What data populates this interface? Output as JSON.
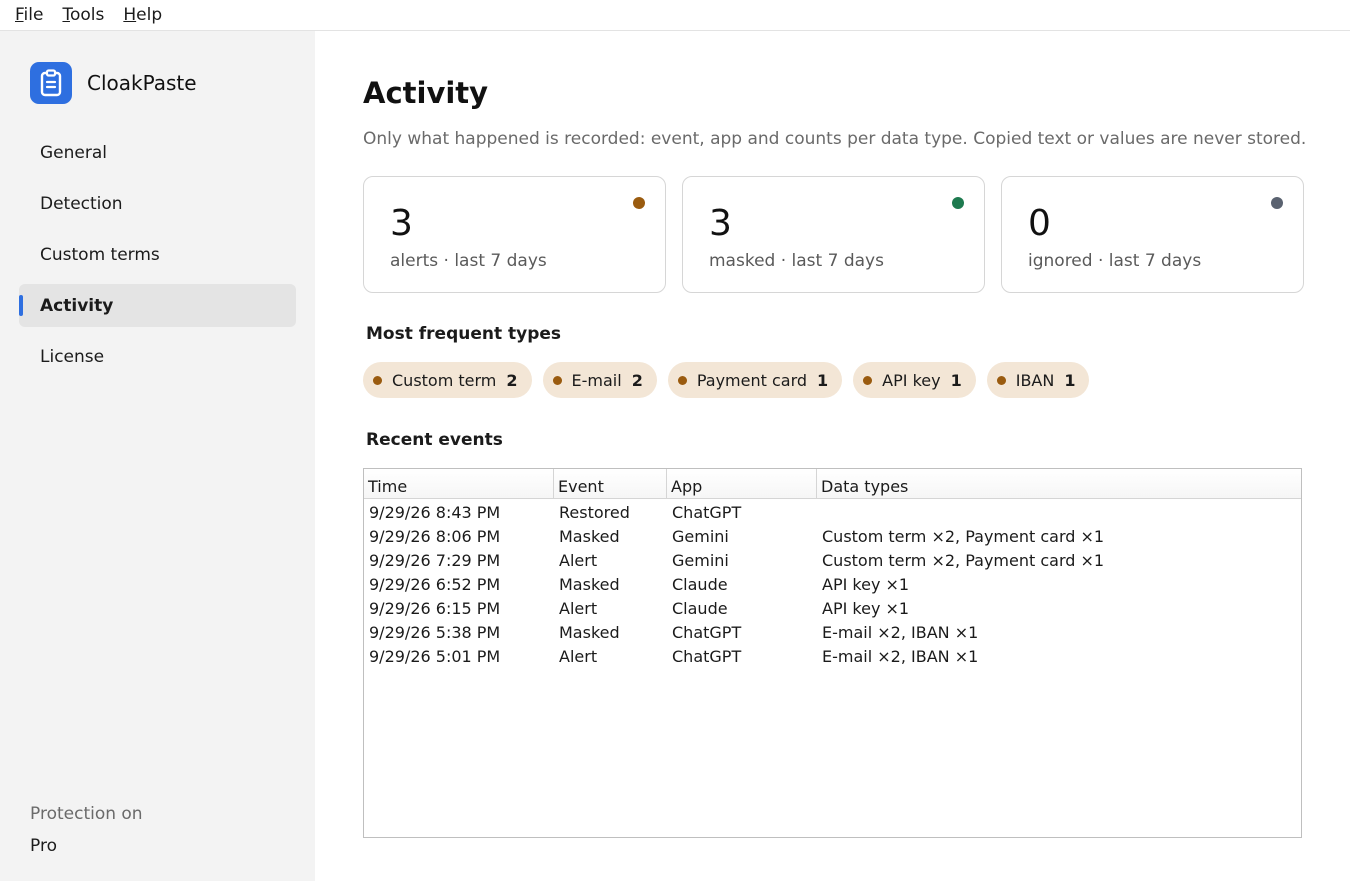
{
  "menu": [
    {
      "mnemonic": "F",
      "rest": "ile"
    },
    {
      "mnemonic": "T",
      "rest": "ools"
    },
    {
      "mnemonic": "H",
      "rest": "elp"
    }
  ],
  "app": {
    "name": "CloakPaste",
    "icon": "clipboard-icon",
    "accent": "#2e6fe0"
  },
  "sidebar": {
    "items": [
      {
        "label": "General"
      },
      {
        "label": "Detection"
      },
      {
        "label": "Custom terms"
      },
      {
        "label": "Activity",
        "active": true
      },
      {
        "label": "License"
      }
    ],
    "status": "Protection on",
    "plan": "Pro"
  },
  "page": {
    "title": "Activity",
    "subtitle": "Only what happened is recorded: event, app and counts per data type. Copied text or values are never stored."
  },
  "cards": [
    {
      "value": "3",
      "label": "alerts · last 7 days",
      "color": "#9a5b0f"
    },
    {
      "value": "3",
      "label": "masked · last 7 days",
      "color": "#1e7a4f"
    },
    {
      "value": "0",
      "label": "ignored · last 7 days",
      "color": "#5a6270"
    }
  ],
  "types": {
    "heading": "Most frequent types",
    "chips": [
      {
        "label": "Custom term",
        "count": "2"
      },
      {
        "label": "E-mail",
        "count": "2"
      },
      {
        "label": "Payment card",
        "count": "1"
      },
      {
        "label": "API key",
        "count": "1"
      },
      {
        "label": "IBAN",
        "count": "1"
      }
    ],
    "chip_color": "#9a5b0f"
  },
  "events": {
    "heading": "Recent events",
    "columns": [
      "Time",
      "Event",
      "App",
      "Data types"
    ],
    "rows": [
      [
        "9/29/26 8:43 PM",
        "Restored",
        "ChatGPT",
        ""
      ],
      [
        "9/29/26 8:06 PM",
        "Masked",
        "Gemini",
        "Custom term ×2, Payment card ×1"
      ],
      [
        "9/29/26 7:29 PM",
        "Alert",
        "Gemini",
        "Custom term ×2, Payment card ×1"
      ],
      [
        "9/29/26 6:52 PM",
        "Masked",
        "Claude",
        "API key ×1"
      ],
      [
        "9/29/26 6:15 PM",
        "Alert",
        "Claude",
        "API key ×1"
      ],
      [
        "9/29/26 5:38 PM",
        "Masked",
        "ChatGPT",
        "E-mail ×2, IBAN ×1"
      ],
      [
        "9/29/26 5:01 PM",
        "Alert",
        "ChatGPT",
        "E-mail ×2, IBAN ×1"
      ]
    ]
  }
}
